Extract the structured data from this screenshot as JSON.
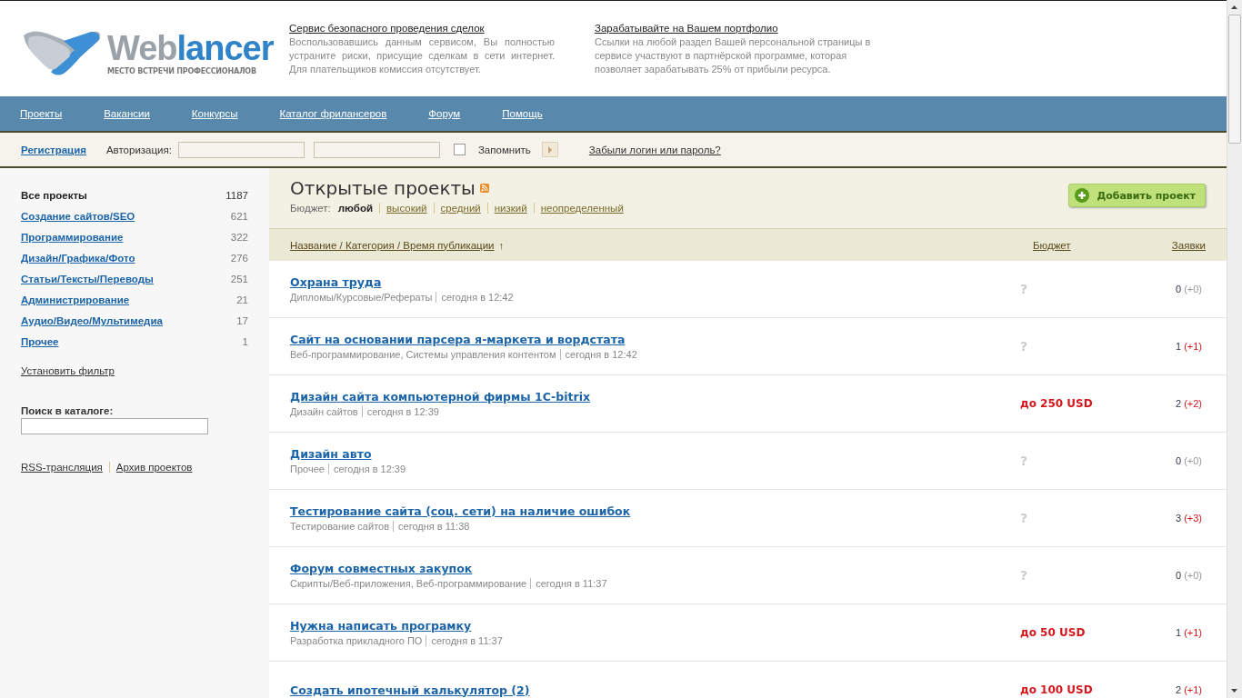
{
  "logo": {
    "wordmark": [
      "Web",
      "lancer"
    ],
    "tagline": "МЕСТО ВСТРЕЧИ ПРОФЕССИОНАЛОВ"
  },
  "promos": [
    {
      "title": "Сервис безопасного проведения сделок",
      "text": "Воспользовавшись данным сервисом, Вы полностью устраните риски, присущие сделкам в сети интернет. Для плательщиков комиссия отсутствует."
    },
    {
      "title": "Зарабатывайте на Вашем портфолио",
      "text": "Ссылки на любой раздел Вашей персональной страницы в сервисе участвуют в партнёрской программе, которая позволяет зарабатывать 25% от прибыли ресурса."
    }
  ],
  "nav": [
    "Проекты",
    "Вакансии",
    "Конкурсы",
    "Каталог фрилансеров",
    "Форум",
    "Помощь"
  ],
  "auth": {
    "register": "Регистрация",
    "label": "Авторизация:",
    "remember": "Запомнить",
    "remember_checked": false,
    "forgot": "Забыли логин или пароль?"
  },
  "sidebar": {
    "categories": [
      {
        "label": "Все проекты",
        "count": "1187",
        "selected": true
      },
      {
        "label": "Создание сайтов/SEO",
        "count": "621",
        "selected": false
      },
      {
        "label": "Программирование",
        "count": "322",
        "selected": false
      },
      {
        "label": "Дизайн/Графика/Фото",
        "count": "276",
        "selected": false
      },
      {
        "label": "Статьи/Тексты/Переводы",
        "count": "251",
        "selected": false
      },
      {
        "label": "Администрирование",
        "count": "21",
        "selected": false
      },
      {
        "label": "Аудио/Видео/Мультимедиа",
        "count": "17",
        "selected": false
      },
      {
        "label": "Прочее",
        "count": "1",
        "selected": false
      }
    ],
    "filter_link": "Установить фильтр",
    "search_label": "Поиск в каталоге:",
    "links": [
      "RSS-трансляция",
      "Архив проектов"
    ]
  },
  "main": {
    "title": "Открытые проекты",
    "budget_label": "Бюджет:",
    "budget_filters": [
      {
        "label": "любой",
        "selected": true
      },
      {
        "label": "высокий",
        "selected": false
      },
      {
        "label": "средний",
        "selected": false
      },
      {
        "label": "низкий",
        "selected": false
      },
      {
        "label": "неопределенный",
        "selected": false
      }
    ],
    "add_button": "Добавить проект",
    "columns": [
      "Название / Категория / Время публикации",
      "Бюджет",
      "Заявки"
    ],
    "sort_arrow": "↑",
    "projects": [
      {
        "title": "Охрана труда",
        "meta": [
          "Дипломы/Курсовые/Рефераты",
          "сегодня в 12:42"
        ],
        "budget": "?",
        "budget_set": false,
        "bids": "0",
        "bids_new": "(+0)",
        "has_new": false
      },
      {
        "title": "Сайт на основании парсера я-маркета и вордстата",
        "meta": [
          "Веб-программирование, Системы управления контентом",
          "сегодня в 12:42"
        ],
        "budget": "?",
        "budget_set": false,
        "bids": "1",
        "bids_new": "(+1)",
        "has_new": true
      },
      {
        "title": "Дизайн сайта компьютерной фирмы 1C-bitrix",
        "meta": [
          "Дизайн сайтов",
          "сегодня в 12:39"
        ],
        "budget": "до 250 USD",
        "budget_set": true,
        "bids": "2",
        "bids_new": "(+2)",
        "has_new": true
      },
      {
        "title": "Дизайн авто",
        "meta": [
          "Прочее",
          "сегодня в 12:39"
        ],
        "budget": "?",
        "budget_set": false,
        "bids": "0",
        "bids_new": "(+0)",
        "has_new": false
      },
      {
        "title": "Тестирование сайта (соц. сети) на наличие ошибок",
        "meta": [
          "Тестирование сайтов",
          "сегодня в 11:38"
        ],
        "budget": "?",
        "budget_set": false,
        "bids": "3",
        "bids_new": "(+3)",
        "has_new": true
      },
      {
        "title": "Форум совместных закупок",
        "meta": [
          "Скрипты/Веб-приложения, Веб-программирование",
          "сегодня в 11:37"
        ],
        "budget": "?",
        "budget_set": false,
        "bids": "0",
        "bids_new": "(+0)",
        "has_new": false
      },
      {
        "title": "Нужна написать програмку",
        "meta": [
          "Разработка прикладного ПО",
          "сегодня в 11:37"
        ],
        "budget": "до 50 USD",
        "budget_set": true,
        "bids": "1",
        "bids_new": "(+1)",
        "has_new": true
      },
      {
        "title": "Создать ипотечный калькулятор (2)",
        "budget": "до 100 USD",
        "budget_set": true,
        "bids": "2",
        "bids_new": "(+1)",
        "has_new": true
      }
    ]
  }
}
